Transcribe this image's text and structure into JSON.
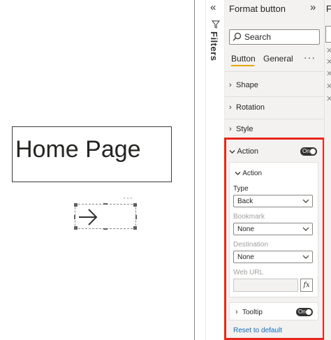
{
  "canvas": {
    "home_text": "Home Page",
    "more_options": "···"
  },
  "filters": {
    "collapse_glyph": "«",
    "label": "Filters"
  },
  "format_pane": {
    "title": "Format button",
    "expand_glyph": "»",
    "search_placeholder": "Search",
    "tabs": [
      {
        "label": "Button",
        "active": true
      },
      {
        "label": "General",
        "active": false
      }
    ],
    "tabs_more": "···",
    "sections": [
      {
        "label": "Shape",
        "expanded": false
      },
      {
        "label": "Rotation",
        "expanded": false
      },
      {
        "label": "Style",
        "expanded": false
      }
    ],
    "action": {
      "label": "Action",
      "toggle_text": "On",
      "card_title": "Action",
      "type_label": "Type",
      "type_value": "Back",
      "bookmark_label": "Bookmark",
      "bookmark_value": "None",
      "destination_label": "Destination",
      "destination_value": "None",
      "web_url_label": "Web URL",
      "web_url_value": "",
      "fx_label": "fx"
    },
    "tooltip": {
      "label": "Tooltip",
      "toggle_text": "On"
    },
    "reset_link": "Reset to default"
  },
  "viz_pane": {
    "title_letter": "F"
  },
  "colors": {
    "highlight": "#e8271c",
    "tab_underline": "#e8a600",
    "toggle_on": "#323130",
    "link": "#0f6cbd"
  },
  "icons": [
    "arrow-right-icon",
    "funnel-icon",
    "search-icon",
    "chevron-right-icon",
    "chevron-down-icon",
    "close-icon"
  ]
}
